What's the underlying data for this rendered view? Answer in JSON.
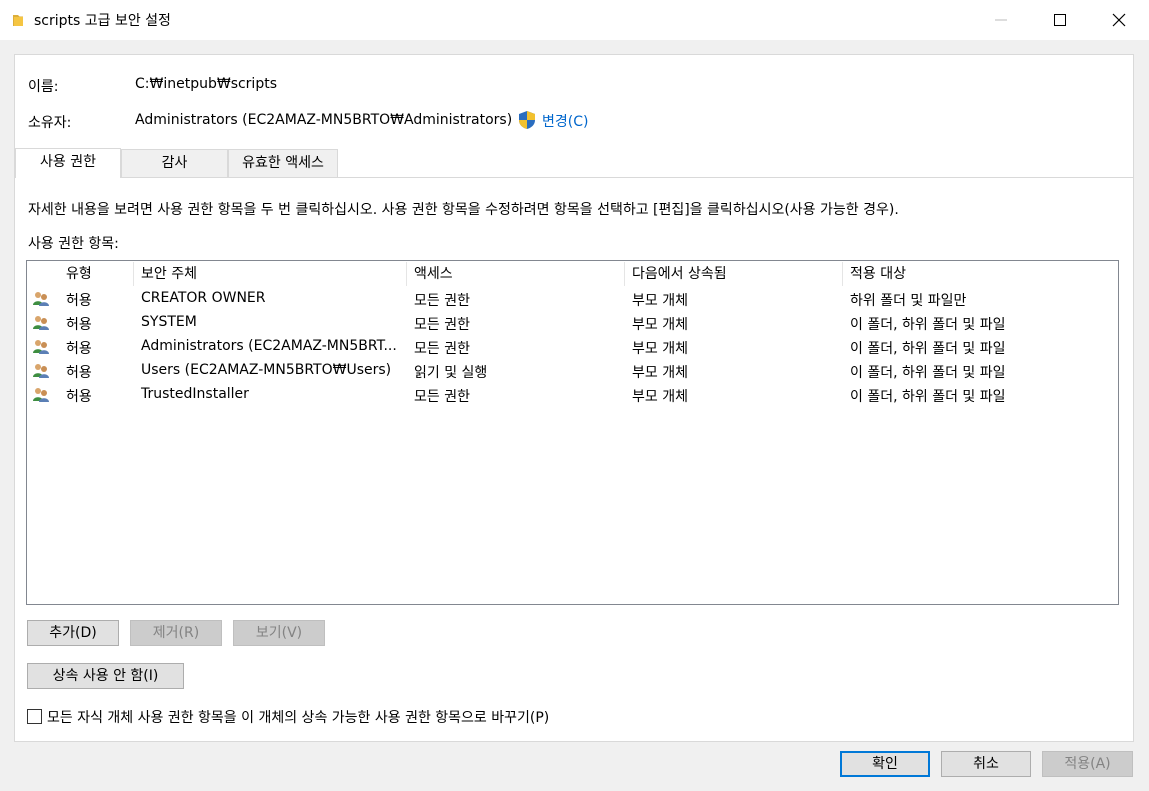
{
  "window": {
    "title": "scripts 고급 보안 설정"
  },
  "info": {
    "name_label": "이름:",
    "name_value": "C:₩inetpub₩scripts",
    "owner_label": "소유자:",
    "owner_value": "Administrators (EC2AMAZ-MN5BRTO₩Administrators)",
    "change_link": "변경(C)"
  },
  "tabs": [
    {
      "label": "사용 권한",
      "active": true
    },
    {
      "label": "감사",
      "active": false
    },
    {
      "label": "유효한 액세스",
      "active": false
    }
  ],
  "instructions": "자세한 내용을 보려면 사용 권한 항목을 두 번 클릭하십시오. 사용 권한 항목을 수정하려면 항목을 선택하고 [편집]을 클릭하십시오(사용 가능한 경우).",
  "entries_label": "사용 권한 항목:",
  "table": {
    "headers": [
      "유형",
      "보안 주체",
      "액세스",
      "다음에서 상속됨",
      "적용 대상"
    ],
    "rows": [
      [
        "허용",
        "CREATOR OWNER",
        "모든 권한",
        "부모 개체",
        "하위 폴더 및 파일만"
      ],
      [
        "허용",
        "SYSTEM",
        "모든 권한",
        "부모 개체",
        "이 폴더, 하위 폴더 및 파일"
      ],
      [
        "허용",
        "Administrators (EC2AMAZ-MN5BRT...",
        "모든 권한",
        "부모 개체",
        "이 폴더, 하위 폴더 및 파일"
      ],
      [
        "허용",
        "Users (EC2AMAZ-MN5BRTO₩Users)",
        "읽기 및 실행",
        "부모 개체",
        "이 폴더, 하위 폴더 및 파일"
      ],
      [
        "허용",
        "TrustedInstaller",
        "모든 권한",
        "부모 개체",
        "이 폴더, 하위 폴더 및 파일"
      ]
    ]
  },
  "buttons": {
    "add": "추가(D)",
    "remove": "제거(R)",
    "view": "보기(V)",
    "disable_inheritance": "상속 사용 안 함(I)",
    "ok": "확인",
    "cancel": "취소",
    "apply": "적용(A)"
  },
  "replace_checkbox": {
    "label": "모든 자식 개체 사용 권한 항목을 이 개체의 상속 가능한 사용 권한 항목으로 바꾸기(P)",
    "checked": false
  },
  "icons": {
    "title": "folder-icon",
    "minimize": "minimize-icon",
    "maximize": "maximize-icon",
    "close": "close-icon",
    "change": "uac-shield-icon",
    "entry": "users-icon"
  },
  "colors": {
    "link": "#0066cc",
    "accent": "#0078d7",
    "folder": "#f5c542"
  }
}
